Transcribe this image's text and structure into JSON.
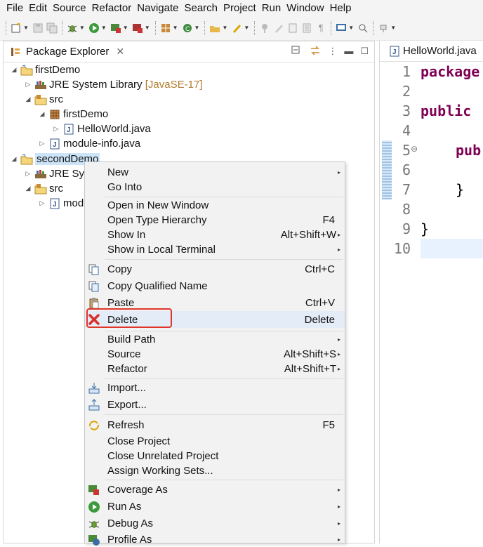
{
  "menubar": [
    "File",
    "Edit",
    "Source",
    "Refactor",
    "Navigate",
    "Search",
    "Project",
    "Run",
    "Window",
    "Help"
  ],
  "package_explorer": {
    "tab_title": "Package Explorer",
    "tree": {
      "first_project": "firstDemo",
      "first_jre": "JRE System Library",
      "first_jre_version": "[JavaSE-17]",
      "first_src": "src",
      "first_package": "firstDemo",
      "first_file": "HelloWorld.java",
      "first_module": "module-info.java",
      "second_project": "secondDemo",
      "second_jre": "JRE Sys",
      "second_src": "src",
      "second_module": "mod"
    }
  },
  "editor": {
    "tab_title": "HelloWorld.java",
    "line_numbers": [
      "1",
      "2",
      "3",
      "4",
      "5",
      "6",
      "7",
      "8",
      "9",
      "10"
    ],
    "line5_marker": "⊖",
    "lines": {
      "l1": "package",
      "l3": "public",
      "l5": "pub",
      "l7": "}",
      "l9": "}"
    }
  },
  "context_menu": {
    "new": "New",
    "go_into": "Go Into",
    "open_new_window": "Open in New Window",
    "open_type_hierarchy": "Open Type Hierarchy",
    "open_type_hierarchy_key": "F4",
    "show_in": "Show In",
    "show_in_key": "Alt+Shift+W",
    "show_local_terminal": "Show in Local Terminal",
    "copy": "Copy",
    "copy_key": "Ctrl+C",
    "copy_qualified": "Copy Qualified Name",
    "paste": "Paste",
    "paste_key": "Ctrl+V",
    "delete": "Delete",
    "delete_key": "Delete",
    "build_path": "Build Path",
    "source": "Source",
    "source_key": "Alt+Shift+S",
    "refactor": "Refactor",
    "refactor_key": "Alt+Shift+T",
    "import": "Import...",
    "export": "Export...",
    "refresh": "Refresh",
    "refresh_key": "F5",
    "close_project": "Close Project",
    "close_unrelated": "Close Unrelated Project",
    "assign_working_sets": "Assign Working Sets...",
    "coverage_as": "Coverage As",
    "run_as": "Run As",
    "debug_as": "Debug As",
    "profile_as": "Profile As"
  },
  "colors": {
    "highlight_box": "#e0362a",
    "keyword": "#7f0055",
    "selection": "#cce4f7"
  }
}
